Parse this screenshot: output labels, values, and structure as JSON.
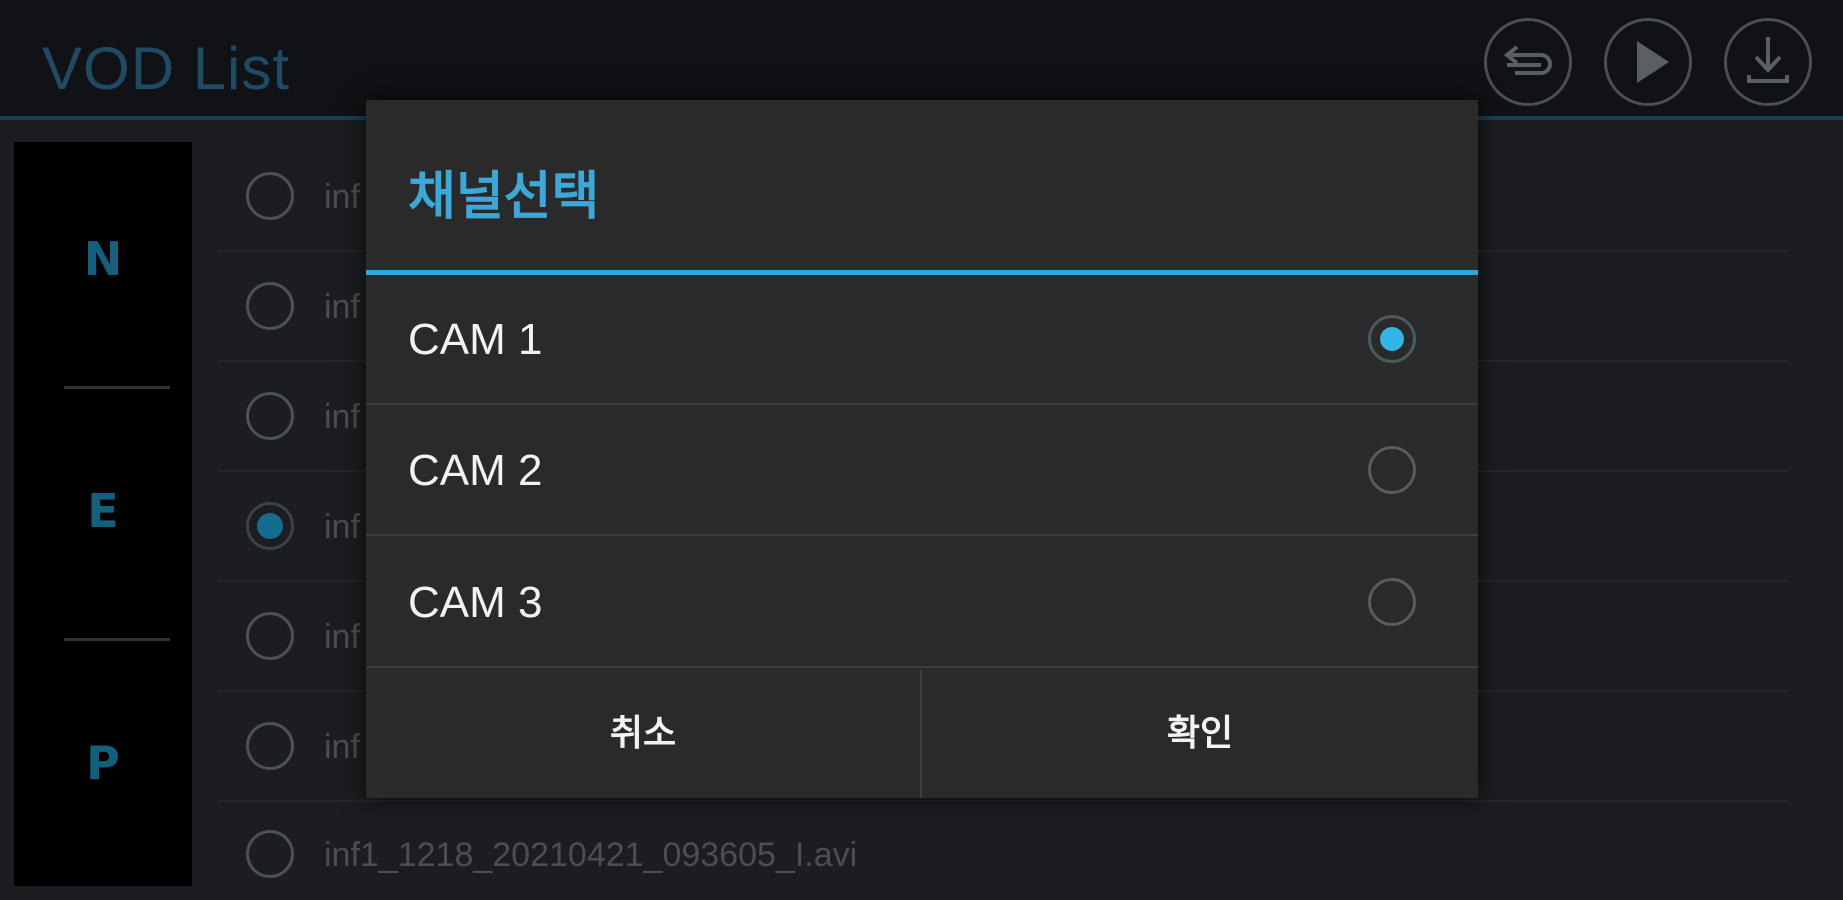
{
  "app": {
    "title": "VOD List",
    "header_buttons": [
      {
        "icon": "return-icon"
      },
      {
        "icon": "play-icon"
      },
      {
        "icon": "download-icon"
      }
    ]
  },
  "sidebar": {
    "items": [
      {
        "label": "N"
      },
      {
        "label": "E"
      },
      {
        "label": "P"
      }
    ]
  },
  "list": {
    "items": [
      {
        "text": "inf",
        "selected": false
      },
      {
        "text": "inf",
        "selected": false
      },
      {
        "text": "inf",
        "selected": false
      },
      {
        "text": "inf",
        "selected": true
      },
      {
        "text": "inf",
        "selected": false
      },
      {
        "text": "inf",
        "selected": false
      },
      {
        "text": "inf1_1218_20210421_093605_I.avi",
        "selected": false
      }
    ]
  },
  "dialog": {
    "title": "채널선택",
    "options": [
      {
        "label": "CAM 1",
        "selected": true
      },
      {
        "label": "CAM 2",
        "selected": false
      },
      {
        "label": "CAM 3",
        "selected": false
      }
    ],
    "cancel_label": "취소",
    "ok_label": "확인"
  },
  "colors": {
    "accent": "#33b5e5",
    "title_accent": "#3aa9d9",
    "sidebar_text": "#12607e"
  }
}
